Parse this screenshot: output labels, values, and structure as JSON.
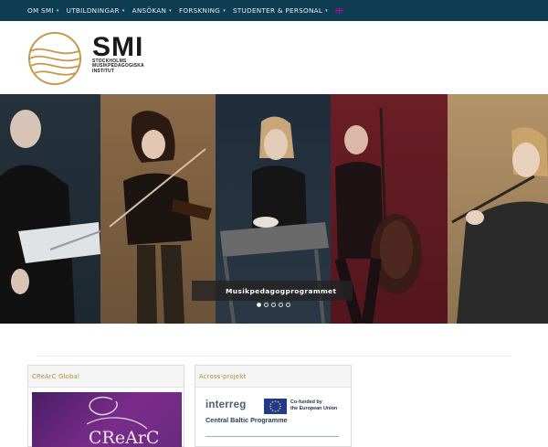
{
  "nav": {
    "items": [
      {
        "label": "OM SMI",
        "caret": "▾"
      },
      {
        "label": "UTBILDNINGAR",
        "caret": "▾"
      },
      {
        "label": "ANSÖKAN",
        "caret": "▾"
      },
      {
        "label": "FORSKNING",
        "caret": "▾"
      },
      {
        "label": "STUDENTER & PERSONAL",
        "caret": "▾"
      }
    ],
    "language_icon": "uk-flag-icon"
  },
  "logo": {
    "title": "SMI",
    "sub_line1": "STOCKHOLMS",
    "sub_line2": "MUSIKPEDAGOGISKA",
    "sub_line3": "INSTITUT"
  },
  "hero": {
    "caption": "Musikpedagogprogrammet",
    "slide_count": 5,
    "active_slide": 1
  },
  "cards": [
    {
      "heading": "CReArC Global",
      "image_text": "CReArC"
    },
    {
      "heading": "Across-projekt",
      "logo_text": "interreg",
      "eu_line1": "Co-funded by",
      "eu_line2": "the European Union",
      "programme": "Central Baltic Programme"
    }
  ],
  "colors": {
    "nav_bg": "#0e3d52",
    "accent_gold": "#b8893a",
    "card_purple": "#5e2477"
  }
}
